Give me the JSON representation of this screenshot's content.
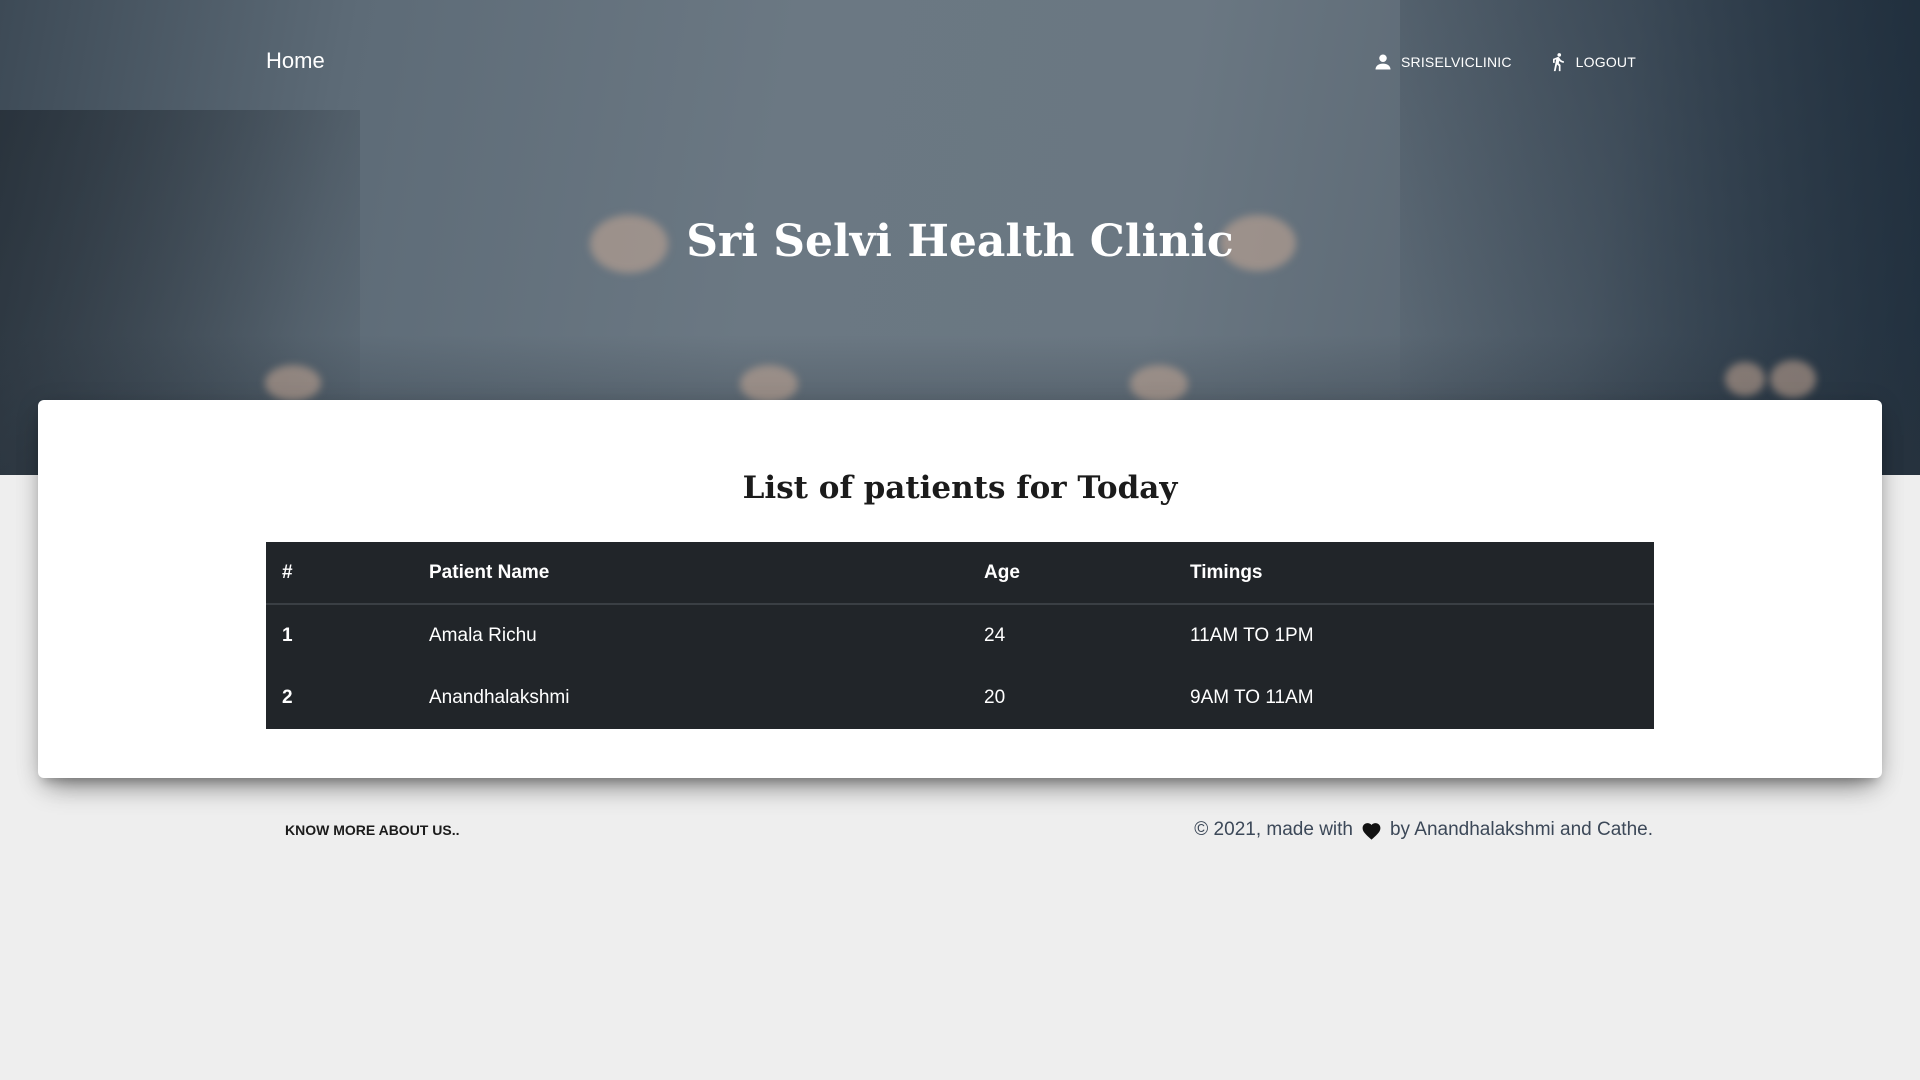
{
  "navbar": {
    "brand": "Home",
    "user_label": "SRISELVICLINIC",
    "logout_label": "LOGOUT"
  },
  "hero": {
    "title": "Sri Selvi Health Clinic"
  },
  "section": {
    "title": "List of patients for Today"
  },
  "table": {
    "headers": [
      "#",
      "Patient Name",
      "Age",
      "Timings"
    ],
    "rows": [
      {
        "num": "1",
        "name": "Amala Richu",
        "age": "24",
        "timing": "11AM TO 1PM"
      },
      {
        "num": "2",
        "name": "Anandhalakshmi",
        "age": "20",
        "timing": "9AM TO 11AM"
      }
    ]
  },
  "footer": {
    "about_link": "KNOW MORE ABOUT US..",
    "copyright_prefix": "© 2021, made with",
    "copyright_suffix": "by Anandhalakshmi and Cathe."
  },
  "icons": {
    "user": "person-icon",
    "logout": "walking-person-icon",
    "love": "heart-icon"
  },
  "colors": {
    "table_bg": "#212529",
    "page_bg": "#eeeeee",
    "card_bg": "#ffffff"
  }
}
